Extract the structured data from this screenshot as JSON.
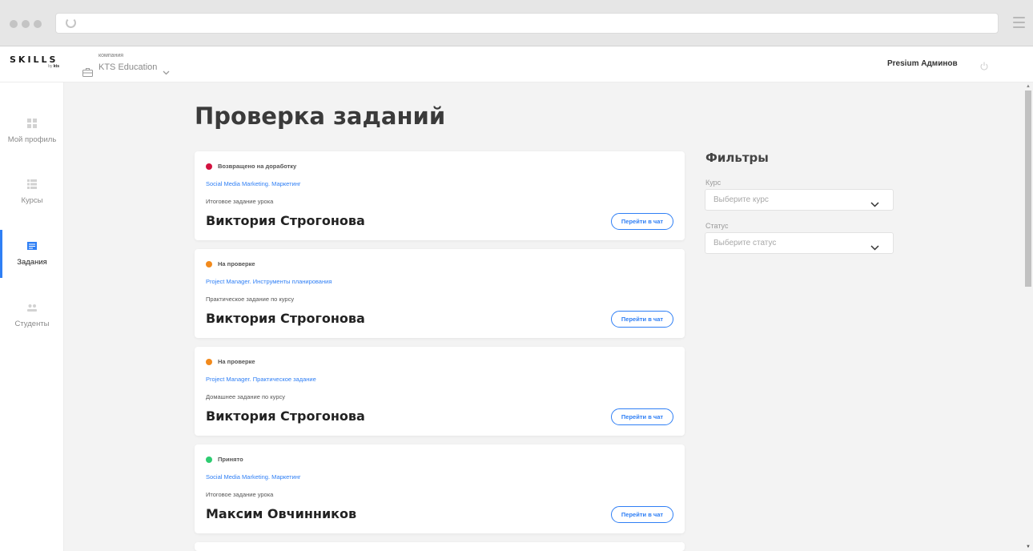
{
  "header": {
    "logo_text": "SKILLS",
    "logo_by": "by",
    "logo_brand": "kts",
    "company_caption": "компания",
    "company_name": "KTS Education",
    "user_name": "Presium Админов"
  },
  "sidebar": {
    "items": [
      {
        "label": "Мой профиль",
        "icon": "dashboard-icon"
      },
      {
        "label": "Курсы",
        "icon": "list-icon"
      },
      {
        "label": "Задания",
        "icon": "tasks-icon"
      },
      {
        "label": "Студенты",
        "icon": "users-icon"
      }
    ],
    "active": "Задания"
  },
  "main": {
    "title": "Проверка заданий",
    "cards": [
      {
        "status": "Возвращено на доработку",
        "status_color": "#d3123f",
        "course": "Social Media Marketing. Маркетинг",
        "task_type": "Итоговое задание урока",
        "student": "Виктория Строгонова",
        "button": "Перейти в чат"
      },
      {
        "status": "На проверке",
        "status_color": "#f28a1c",
        "course": "Project Manager. Инструменты планирования",
        "task_type": "Практическое задание по курсу",
        "student": "Виктория Строгонова",
        "button": "Перейти в чат"
      },
      {
        "status": "На проверке",
        "status_color": "#f28a1c",
        "course": "Project Manager. Практическое задание",
        "task_type": "Домашнее задание по курсу",
        "student": "Виктория Строгонова",
        "button": "Перейти в чат"
      },
      {
        "status": "Принято",
        "status_color": "#2ecc71",
        "course": "Social Media Marketing. Маркетинг",
        "task_type": "Итоговое задание урока",
        "student": "Максим Овчинников",
        "button": "Перейти в чат"
      }
    ]
  },
  "filters": {
    "title": "Фильтры",
    "course_label": "Курс",
    "course_placeholder": "Выберите курс",
    "status_label": "Статус",
    "status_placeholder": "Выберите статус"
  },
  "colors": {
    "accent": "#2f7ff5",
    "background": "#f3f3f3"
  }
}
